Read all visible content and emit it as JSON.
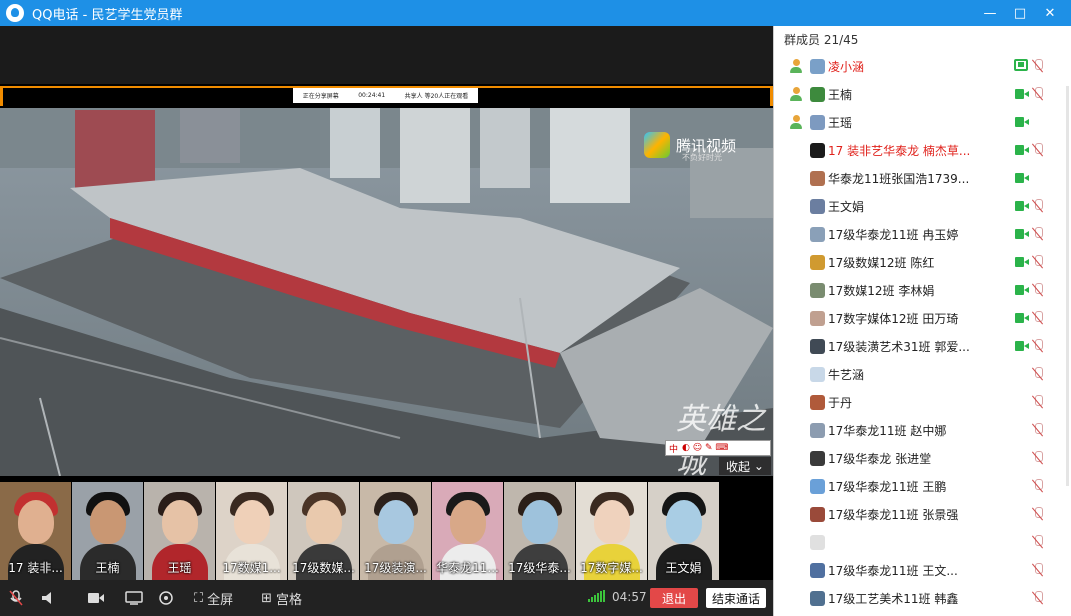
{
  "window": {
    "app_name": "QQ电话",
    "separator": "-",
    "group_name": "民艺学生党员群",
    "controls": [
      "—",
      "□",
      "✕"
    ]
  },
  "share_info": {
    "left": "正在分享屏幕",
    "time": "00:24:41",
    "right": "共享人 等20人正在观看"
  },
  "video": {
    "brand": "腾讯视频",
    "brand_slogan": "不负好时光",
    "watermark": "英雄之城",
    "ime_label": "中",
    "collapse_label": "收起"
  },
  "thumbnails": [
    {
      "name": "17 装非..."
    },
    {
      "name": "王楠"
    },
    {
      "name": "王瑶"
    },
    {
      "name": "17数媒1..."
    },
    {
      "name": "17级数媒..."
    },
    {
      "name": "17级装演..."
    },
    {
      "name": "华泰龙11..."
    },
    {
      "name": "17级华泰..."
    },
    {
      "name": "17数字媒..."
    },
    {
      "name": "王文娟"
    }
  ],
  "toolbar": {
    "fullscreen_label": "全屏",
    "grid_label": "宫格",
    "timer": "04:57",
    "exit_label": "退出",
    "end_call_label": "结束通话"
  },
  "members": {
    "header": "群成员 21/45",
    "list": [
      {
        "name": "凌小涵",
        "red": true,
        "admin": true,
        "screen": true,
        "cam": false,
        "muted": true
      },
      {
        "name": "王楠",
        "red": false,
        "admin": true,
        "screen": false,
        "cam": true,
        "muted": true
      },
      {
        "name": "王瑶",
        "red": false,
        "admin": true,
        "screen": false,
        "cam": true,
        "muted": false
      },
      {
        "name": "17 装非艺华泰龙  楠杰草...",
        "red": true,
        "admin": false,
        "screen": false,
        "cam": true,
        "muted": true
      },
      {
        "name": "华泰龙11班张国浩1739...",
        "red": false,
        "admin": false,
        "screen": false,
        "cam": true,
        "muted": false
      },
      {
        "name": "王文娟",
        "red": false,
        "admin": false,
        "screen": false,
        "cam": true,
        "muted": true
      },
      {
        "name": "17级华泰龙11班 冉玉婷",
        "red": false,
        "admin": false,
        "screen": false,
        "cam": true,
        "muted": true
      },
      {
        "name": "17级数媒12班  陈红",
        "red": false,
        "admin": false,
        "screen": false,
        "cam": true,
        "muted": true
      },
      {
        "name": "17数媒12班    李林娟",
        "red": false,
        "admin": false,
        "screen": false,
        "cam": true,
        "muted": true
      },
      {
        "name": "17数字媒体12班 田万琦",
        "red": false,
        "admin": false,
        "screen": false,
        "cam": true,
        "muted": true
      },
      {
        "name": "17级装潢艺术31班  郭爱...",
        "red": false,
        "admin": false,
        "screen": false,
        "cam": true,
        "muted": true
      },
      {
        "name": "牛艺涵",
        "red": false,
        "admin": false,
        "screen": false,
        "cam": false,
        "muted": true
      },
      {
        "name": "于丹",
        "red": false,
        "admin": false,
        "screen": false,
        "cam": false,
        "muted": true
      },
      {
        "name": "17华泰龙11班   赵中娜",
        "red": false,
        "admin": false,
        "screen": false,
        "cam": false,
        "muted": true
      },
      {
        "name": "17级华泰龙  张进堂",
        "red": false,
        "admin": false,
        "screen": false,
        "cam": false,
        "muted": true
      },
      {
        "name": "17级华泰龙11班  王鹏",
        "red": false,
        "admin": false,
        "screen": false,
        "cam": false,
        "muted": true
      },
      {
        "name": "17级华泰龙11班 张景强",
        "red": false,
        "admin": false,
        "screen": false,
        "cam": false,
        "muted": true
      },
      {
        "name": "",
        "red": false,
        "admin": false,
        "screen": false,
        "cam": false,
        "muted": true
      },
      {
        "name": "17级华泰龙11班      王文...",
        "red": false,
        "admin": false,
        "screen": false,
        "cam": false,
        "muted": true
      },
      {
        "name": "17级工艺美术11班 韩鑫",
        "red": false,
        "admin": false,
        "screen": false,
        "cam": false,
        "muted": true
      }
    ]
  },
  "colors": {
    "titlebar": "#1e90e6",
    "share_border": "#f08c00",
    "exit": "#e34848",
    "active_green": "#2bb34a",
    "admin_red": "#e0211b"
  }
}
